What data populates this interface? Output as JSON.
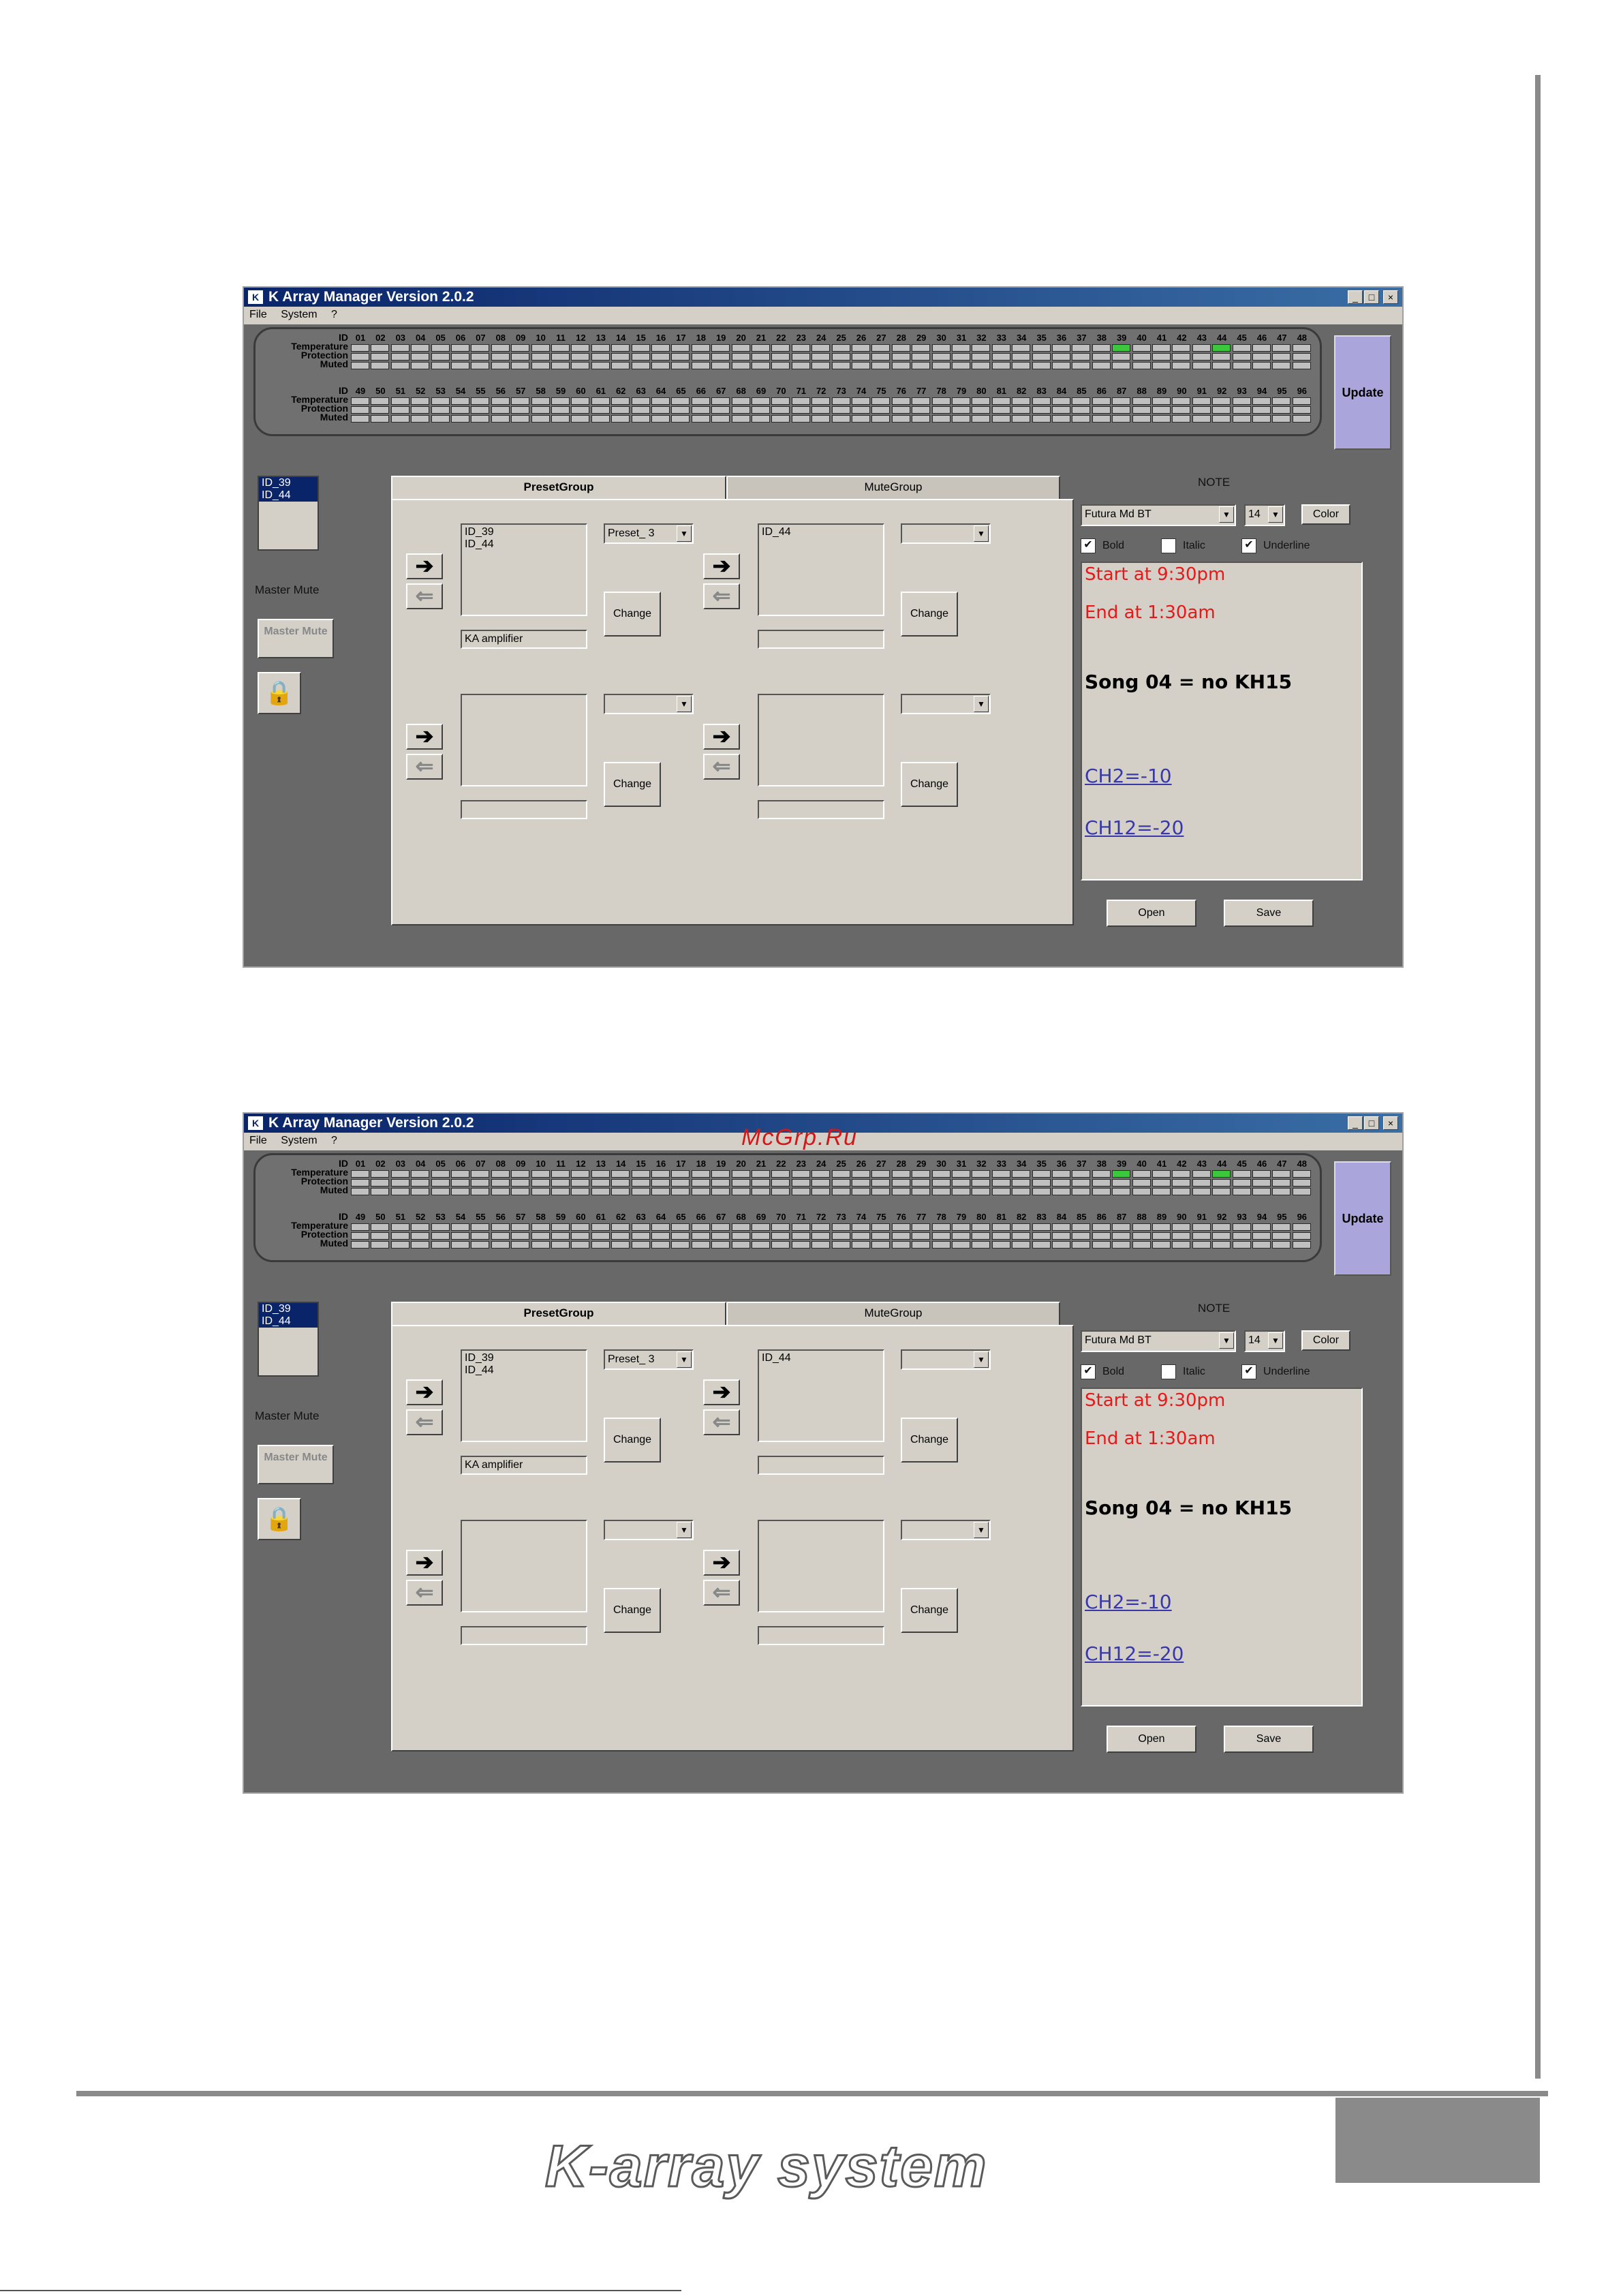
{
  "window": {
    "title": "K Array Manager Version 2.0.2",
    "menu": [
      "File",
      "System",
      "?"
    ]
  },
  "status": {
    "row_labels": [
      "ID",
      "Temperature",
      "Protection",
      "Muted"
    ],
    "ids_top": [
      "01",
      "02",
      "03",
      "04",
      "05",
      "06",
      "07",
      "08",
      "09",
      "10",
      "11",
      "12",
      "13",
      "14",
      "15",
      "16",
      "17",
      "18",
      "19",
      "20",
      "21",
      "22",
      "23",
      "24",
      "25",
      "26",
      "27",
      "28",
      "29",
      "30",
      "31",
      "32",
      "33",
      "34",
      "35",
      "36",
      "37",
      "38",
      "39",
      "40",
      "41",
      "42",
      "43",
      "44",
      "45",
      "46",
      "47",
      "48"
    ],
    "ids_bottom": [
      "49",
      "50",
      "51",
      "52",
      "53",
      "54",
      "55",
      "56",
      "57",
      "58",
      "59",
      "60",
      "61",
      "62",
      "63",
      "64",
      "65",
      "66",
      "67",
      "68",
      "69",
      "70",
      "71",
      "72",
      "73",
      "74",
      "75",
      "76",
      "77",
      "78",
      "79",
      "80",
      "81",
      "82",
      "83",
      "84",
      "85",
      "86",
      "87",
      "88",
      "89",
      "90",
      "91",
      "92",
      "93",
      "94",
      "95",
      "96"
    ],
    "active_protection_ids": [
      "39",
      "44"
    ],
    "active_color": "#3cc83c",
    "update_label": "Update"
  },
  "left": {
    "selected_ids": [
      "ID_39",
      "ID_44"
    ],
    "master_mute_label": "Master Mute",
    "master_mute_button": "Master Mute",
    "lock_icon": "lock-icon"
  },
  "tabs": [
    "PresetGroup",
    "MuteGroup"
  ],
  "groups": [
    {
      "items": "ID_39\nID_44",
      "preset": "Preset_ 3",
      "name": "KA amplifier"
    },
    {
      "items": "ID_44",
      "preset": "",
      "name": ""
    },
    {
      "items": "",
      "preset": "",
      "name": ""
    },
    {
      "items": "",
      "preset": "",
      "name": ""
    }
  ],
  "change_label": "Change",
  "note": {
    "label": "NOTE",
    "font": "Futura Md BT",
    "size": "14",
    "color_button": "Color",
    "bold_label": "Bold",
    "italic_label": "Italic",
    "underline_label": "Underline",
    "lines": [
      "Start at 9:30pm",
      "End at 1:30am",
      "Song 04 = no KH15",
      "CH2=-10",
      "CH12=-20"
    ],
    "open_label": "Open",
    "save_label": "Save"
  },
  "watermark": "McGrp.Ru",
  "footer": {
    "brand": "K-array system"
  }
}
